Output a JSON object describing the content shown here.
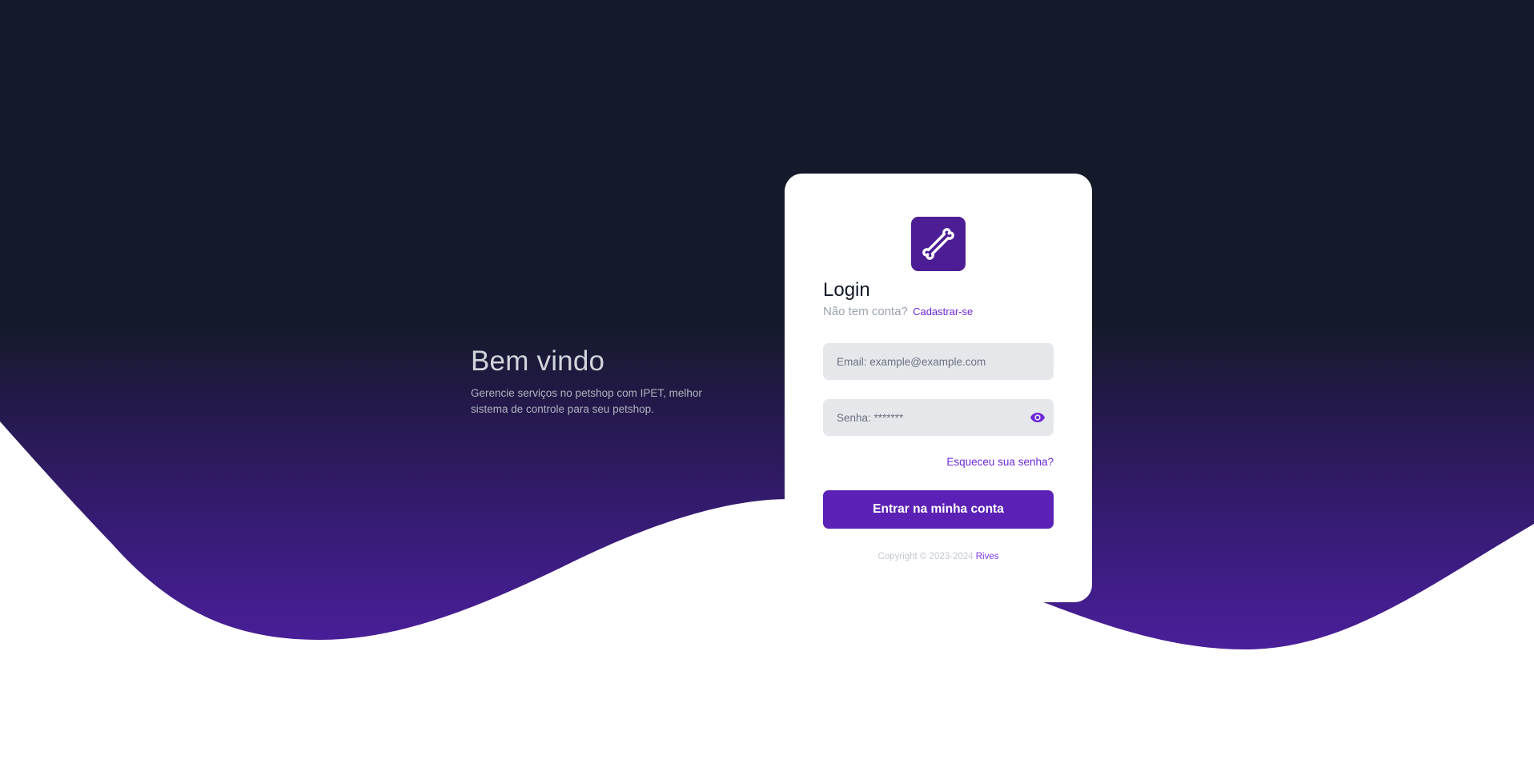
{
  "welcome": {
    "heading": "Bem vindo",
    "description": "Gerencie serviços no petshop com IPET, melhor sistema de controle para seu petshop."
  },
  "login": {
    "logo_icon": "bone-icon",
    "title": "Login",
    "no_account_text": "Não tem conta?",
    "signup_link": "Cadastrar-se",
    "email_placeholder": "Email: example@example.com",
    "email_value": "",
    "password_placeholder": "Senha: *******",
    "password_value": "",
    "show_password_icon": "eye-icon",
    "forgot_password": "Esqueceu sua senha?",
    "submit_label": "Entrar na minha conta"
  },
  "footer": {
    "copyright_text": "Copyright © 2023-2024",
    "brand_link": "Rives"
  },
  "colors": {
    "background_dark": "#141a2a",
    "wave_purple": "#4a1f9a",
    "accent": "#5b21b6",
    "card": "#ffffff"
  }
}
